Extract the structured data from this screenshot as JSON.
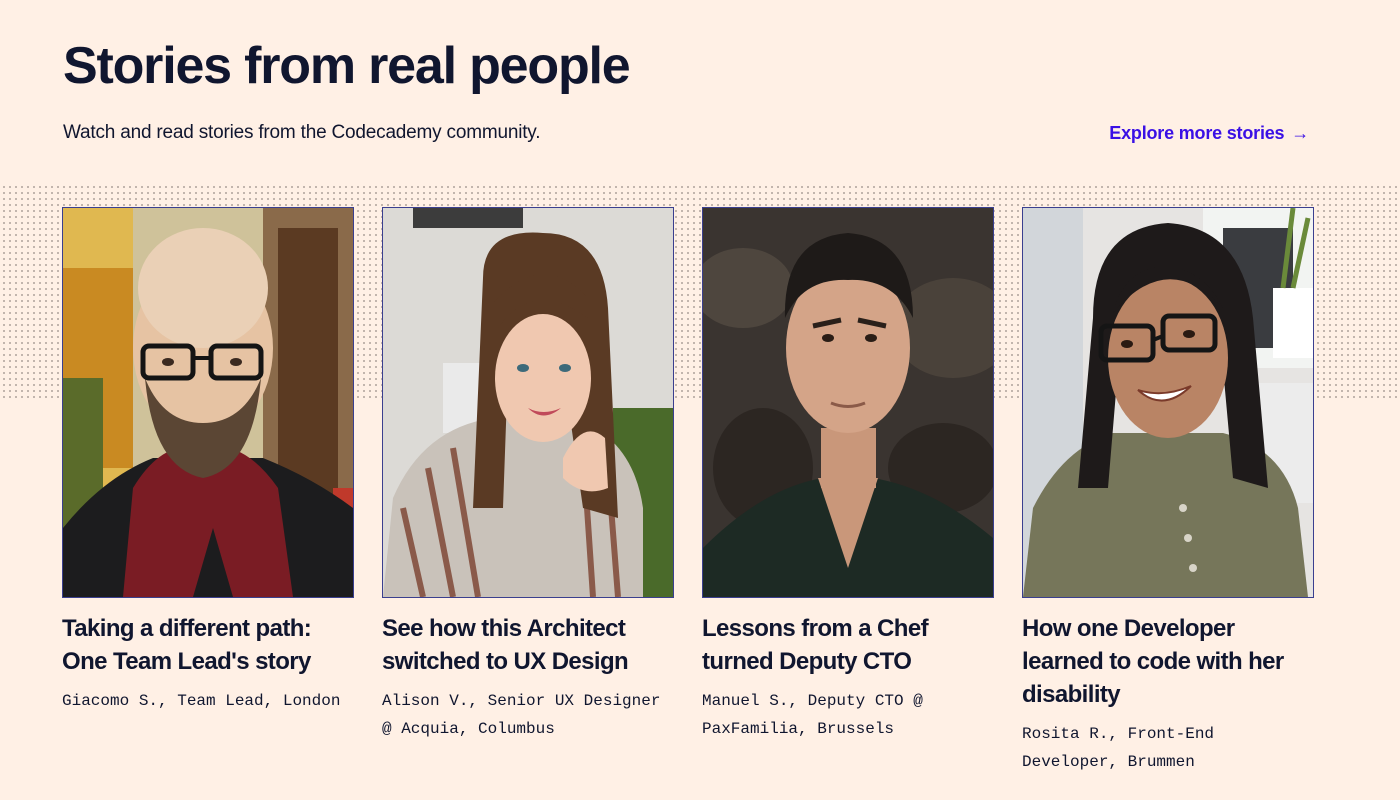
{
  "header": {
    "title": "Stories from real people",
    "subtitle": "Watch and read stories from the Codecademy community.",
    "explore_link": "Explore more stories",
    "explore_arrow": "→"
  },
  "colors": {
    "background": "#fff0e5",
    "text": "#10162f",
    "link": "#3a10e5",
    "photo_border": "#3a3f8f"
  },
  "stories": [
    {
      "title": "Taking a different path: One Team Lead's story",
      "meta": "Giacomo S., Team Lead, London"
    },
    {
      "title": "See how this Architect switched to UX Design",
      "meta": "Alison V., Senior UX Designer @ Acquia, Columbus"
    },
    {
      "title": "Lessons from a Chef turned Deputy CTO",
      "meta": "Manuel S., Deputy CTO @ PaxFamilia, Brussels"
    },
    {
      "title": "How one Developer learned to code with her disability",
      "meta": "Rosita R., Front-End Developer, Brummen"
    }
  ]
}
